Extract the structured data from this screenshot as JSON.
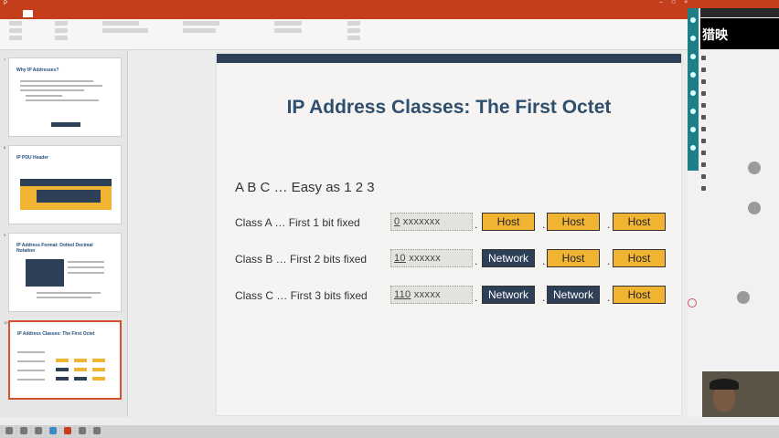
{
  "window": {
    "title": "",
    "controls": [
      "–",
      "□",
      "×"
    ]
  },
  "ribbon": {
    "tabs": [
      "",
      "",
      "",
      "",
      "",
      "",
      "",
      "",
      "",
      "",
      "",
      "",
      ""
    ]
  },
  "thumbnails": [
    {
      "number": "7",
      "title": "Why IP Addresses?"
    },
    {
      "number": "8",
      "title": "IP PDU Header"
    },
    {
      "number": "9",
      "title": "IP Address Format: Dotted Decimal Notation"
    },
    {
      "number": "10",
      "title": "IP Address Classes: The First Octet"
    }
  ],
  "slide": {
    "title": "IP Address Classes: The First Octet",
    "subtitle": "A B C … Easy as 1 2 3",
    "rows": [
      {
        "label": "Class A … First 1 bit fixed",
        "fixed": "0",
        "rest": "xxxxxxx",
        "segments": [
          "Host",
          "Host",
          "Host"
        ],
        "types": [
          "host",
          "host",
          "host"
        ]
      },
      {
        "label": "Class B … First 2 bits fixed",
        "fixed": "10",
        "rest": "xxxxxx",
        "segments": [
          "Network",
          "Host",
          "Host"
        ],
        "types": [
          "network",
          "host",
          "host"
        ]
      },
      {
        "label": "Class C … First 3 bits fixed",
        "fixed": "110",
        "rest": "xxxxx",
        "segments": [
          "Network",
          "Network",
          "Host"
        ],
        "types": [
          "network",
          "network",
          "host"
        ]
      }
    ],
    "separator": "."
  },
  "sidepanel": {
    "banner": "猎映"
  },
  "colors": {
    "accent": "#c43e1c",
    "network": "#2e4057",
    "host": "#f0b432",
    "title": "#2e4f6e"
  }
}
